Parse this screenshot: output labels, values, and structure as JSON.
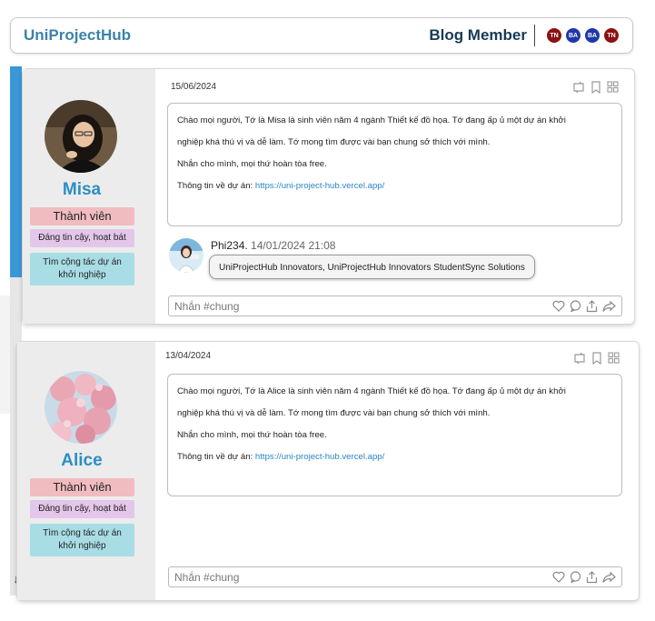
{
  "header": {
    "brand": "UniProjectHub",
    "section_title": "Blog Member",
    "members": [
      {
        "initials": "TN",
        "color": "#8b1212"
      },
      {
        "initials": "BA",
        "color": "#1f38a8"
      },
      {
        "initials": "BA",
        "color": "#1f38a8"
      },
      {
        "initials": "TN",
        "color": "#8b1212"
      }
    ]
  },
  "posts": [
    {
      "date": "15/06/2024",
      "author": {
        "name": "Misa",
        "role": "Thành viên",
        "trust": "Đáng tin cậy, hoạt bát",
        "seeking": "Tìm cộng tác dự án khởi nghiệp"
      },
      "body": [
        "Chào mọi người, Tớ là Misa là sinh viên năm 4 ngành Thiết kế đồ họa. Tớ đang ấp ủ một dự án khởi",
        "nghiệp khá thú vị và dễ làm. Tớ mong tìm được vài bạn chung sở thích với mình.",
        "Nhắn cho mình, mọi thứ hoàn tòa free."
      ],
      "link_label": "Thông tin về dự án:",
      "link_url": "https://uni-project-hub.vercel.app/",
      "comment": {
        "user": "Phi234.",
        "timestamp": "14/01/2024 21:08",
        "text": "UniProjectHub Innovators, UniProjectHub Innovators StudentSync Solutions"
      },
      "reply_placeholder": "Nhắn #chung"
    },
    {
      "date": "13/04/2024",
      "author": {
        "name": "Alice",
        "role": "Thành viên",
        "trust": "Đáng tin cậy, hoạt bát",
        "seeking": "Tìm cộng tác dự án khởi nghiệp"
      },
      "body": [
        "Chào mọi người, Tớ là Alice là sinh viên năm 4 ngành Thiết kế đồ họa. Tớ đang ấp ủ một dự án khởi",
        "nghiệp khá thú vị và dễ làm. Tớ mong tìm được vài bạn chung sở thích với mình.",
        "Nhắn cho mình, mọi thứ hoàn tòa free."
      ],
      "link_label": "Thông tin về dự án:",
      "link_url": "https://uni-project-hub.vercel.app/",
      "reply_placeholder": "Nhắn #chung"
    }
  ],
  "icons": {
    "repost": "repost-icon",
    "bookmark": "bookmark-icon",
    "grid": "grid-icon",
    "like": "heart-icon",
    "comment": "comment-icon",
    "share": "share-icon",
    "forward": "forward-icon",
    "scroll_down": "arrow-down-icon"
  },
  "colors": {
    "accent": "#2a8fc4",
    "brand": "#3b82a8",
    "scroll_thumb": "#3a98d6",
    "badge_member": "#f1bcc0",
    "badge_trust": "#e4c6ea",
    "badge_seek": "#a9dde6"
  }
}
